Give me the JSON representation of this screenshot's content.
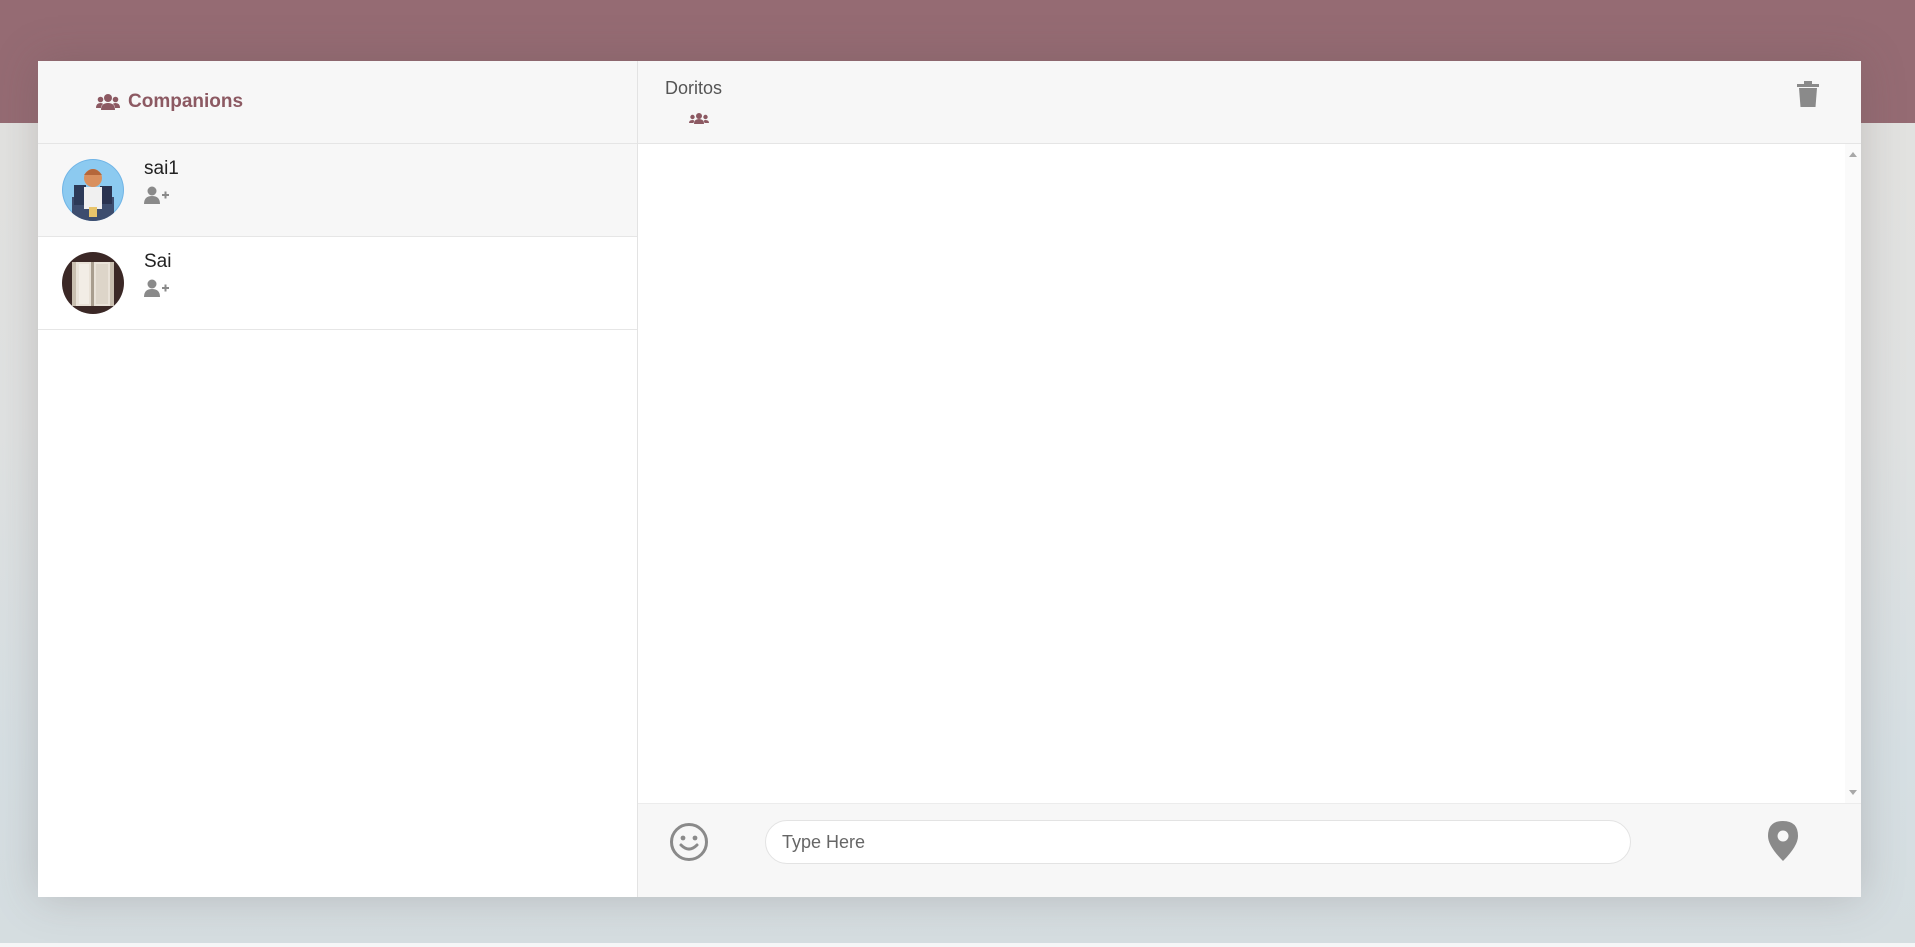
{
  "sidebar": {
    "header": {
      "icon": "users-icon",
      "title": "Companions"
    },
    "companions": [
      {
        "name": "sai1",
        "avatar": "avatar-cartoon-figure",
        "action_icon": "user-plus-icon",
        "active": true
      },
      {
        "name": "Sai",
        "avatar": "avatar-book",
        "action_icon": "user-plus-icon",
        "active": false
      }
    ]
  },
  "chat": {
    "title": "Doritos",
    "title_icon": "group-icon",
    "delete_icon": "trash-icon",
    "input": {
      "placeholder": "Type Here",
      "value": ""
    },
    "emoji_icon": "smiley-icon",
    "location_icon": "map-marker-icon"
  },
  "colors": {
    "accent": "#8c5962",
    "top_band": "#956b73",
    "header_bg": "#f7f7f7"
  }
}
